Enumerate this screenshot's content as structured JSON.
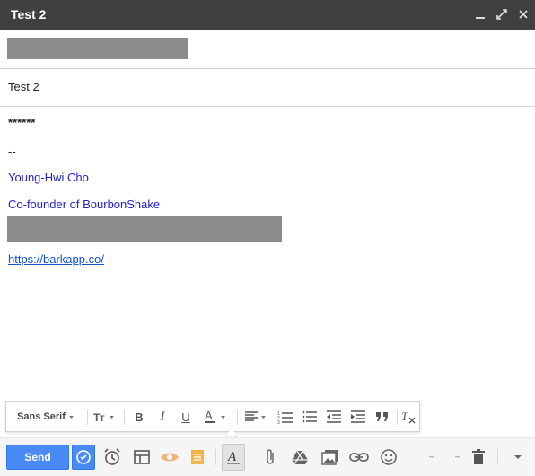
{
  "window": {
    "title": "Test 2",
    "minimize_icon": "minimize-icon",
    "expand_icon": "expand-icon",
    "close_icon": "close-icon"
  },
  "subject": {
    "value": "Test 2"
  },
  "body": {
    "line1": "******",
    "signature_dash": "--",
    "signature_name": "Young-Hwi Cho",
    "signature_title": "Co-founder of BourbonShake",
    "signature_link": "https://barkapp.co/"
  },
  "format_toolbar": {
    "font_family": "Sans Serif",
    "size_icon": "font-size-icon",
    "bold": "B",
    "italic": "I",
    "underline": "U",
    "text_color_icon": "text-color-icon",
    "align_icon": "align-icon",
    "numbered_list_icon": "numbered-list-icon",
    "bulleted_list_icon": "bulleted-list-icon",
    "indent_less_icon": "indent-less-icon",
    "indent_more_icon": "indent-more-icon",
    "quote_icon": "quote-icon",
    "remove_formatting_icon": "remove-formatting-icon"
  },
  "bottom_toolbar": {
    "send_label": "Send",
    "colors": {
      "send": "#4a8af4",
      "titlebar": "#404040",
      "signature": "#2222cc",
      "link": "#1155cc",
      "eye": "#f2b27a",
      "doc": "#f0b64c"
    }
  }
}
